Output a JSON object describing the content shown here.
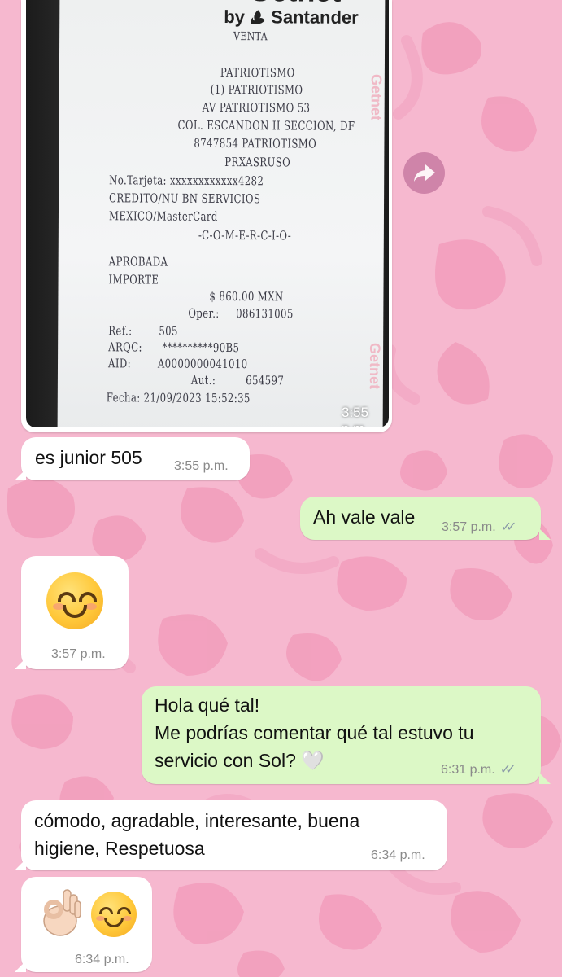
{
  "colors": {
    "wallpaper": "#f6b8cf",
    "incoming_bubble": "#ffffff",
    "outgoing_bubble": "#dcf8c6",
    "timestamp": "#8a8a8a"
  },
  "receipt": {
    "brand": "Getnet",
    "by_line": "by",
    "bank": "Santander",
    "type": "VENTA",
    "lines": [
      "PATRIOTISMO",
      "(1) PATRIOTISMO",
      "AV PATRIOTISMO 53",
      "COL. ESCANDON II SECCION, DF",
      "8747854 PATRIOTISMO",
      "PRXASRUSO"
    ],
    "card_no_label": "No.Tarjeta:",
    "card_no": "xxxxxxxxxxxx4282",
    "card_type": "CREDITO/NU BN SERVICIOS",
    "card_brand": "MEXICO/MasterCard",
    "commerce": "-C-O-M-E-R-C-I-O-",
    "status": "APROBADA",
    "amount_label": "IMPORTE",
    "amount": "$ 860.00 MXN",
    "oper_label": "Oper.:",
    "oper": "086131005",
    "ref_label": "Ref.:",
    "ref": "505",
    "arqc_label": "ARQC:",
    "arqc": "**********90B5",
    "aid_label": "AID:",
    "aid": "A0000000041010",
    "aut_label": "Aut.:",
    "aut": "654597",
    "fecha": "Fecha: 21/09/2023 15:52:35",
    "watermark": "Getnet",
    "time": "3:55 p.m."
  },
  "messages": [
    {
      "id": "m1",
      "dir": "in",
      "text": "es junior 505",
      "time": "3:55 p.m."
    },
    {
      "id": "m2",
      "dir": "out",
      "text": "Ah vale vale",
      "time": "3:57 p.m."
    },
    {
      "id": "m3",
      "dir": "in",
      "emoji": "smiling-face-icon",
      "time": "3:57 p.m."
    },
    {
      "id": "m4",
      "dir": "out",
      "lines": [
        "Hola qué tal!",
        "Me podrías comentar qué tal estuvo tu",
        "servicio con Sol? 🤍"
      ],
      "time": "6:31 p.m."
    },
    {
      "id": "m5",
      "dir": "in",
      "lines": [
        "cómodo, agradable, interesante, buena",
        "higiene, Respetuosa"
      ],
      "time": "6:34 p.m."
    },
    {
      "id": "m6",
      "dir": "in",
      "emoji": "ok-hand-and-smiling-face-icons",
      "time": "6:34 p.m."
    }
  ],
  "icons": {
    "forward": "forward-share-icon",
    "read_ticks": "double-check-icon"
  }
}
